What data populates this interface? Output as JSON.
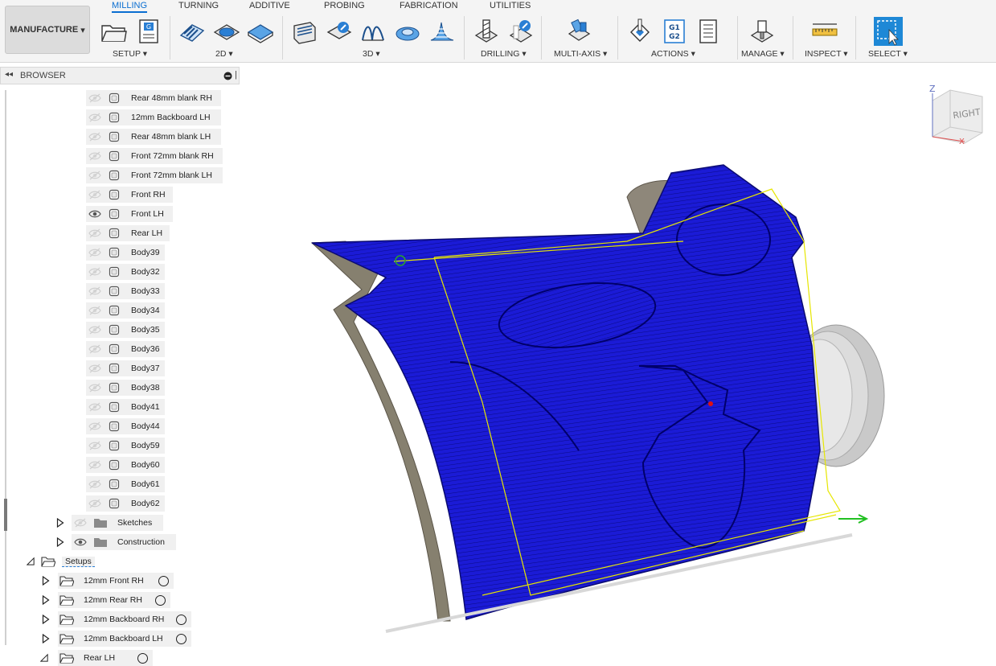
{
  "workspace": "MANUFACTURE",
  "tabs": [
    "MILLING",
    "TURNING",
    "ADDITIVE",
    "PROBING",
    "FABRICATION",
    "UTILITIES"
  ],
  "active_tab": "MILLING",
  "groups": [
    "SETUP ▾",
    "2D ▾",
    "3D ▾",
    "DRILLING ▾",
    "MULTI-AXIS ▾",
    "ACTIONS ▾",
    "MANAGE ▾",
    "INSPECT ▾",
    "SELECT ▾"
  ],
  "browser": {
    "title": "BROWSER"
  },
  "bodies": [
    "Rear 48mm blank RH",
    "12mm Backboard LH",
    "Rear 48mm blank LH",
    "Front  72mm blank RH",
    "Front  72mm blank LH",
    "Front RH",
    "Front LH",
    "Rear LH",
    "Body39",
    "Body32",
    "Body33",
    "Body34",
    "Body35",
    "Body36",
    "Body37",
    "Body38",
    "Body41",
    "Body44",
    "Body59",
    "Body60",
    "Body61",
    "Body62"
  ],
  "visible_body": "Front LH",
  "folders": [
    "Sketches",
    "Construction"
  ],
  "setups_label": "Setups",
  "setups": [
    "12mm Front RH",
    "12mm Rear RH",
    "12mm Backboard RH",
    "12mm Backboard LH",
    "Rear LH"
  ],
  "viewcube": {
    "face": "RIGHT",
    "axis_z": "Z",
    "axis_x": "X"
  },
  "colors": {
    "accent": "#0a6ed1",
    "toolpath": "#1a1ad8",
    "select_blue": "#1e88d6"
  }
}
